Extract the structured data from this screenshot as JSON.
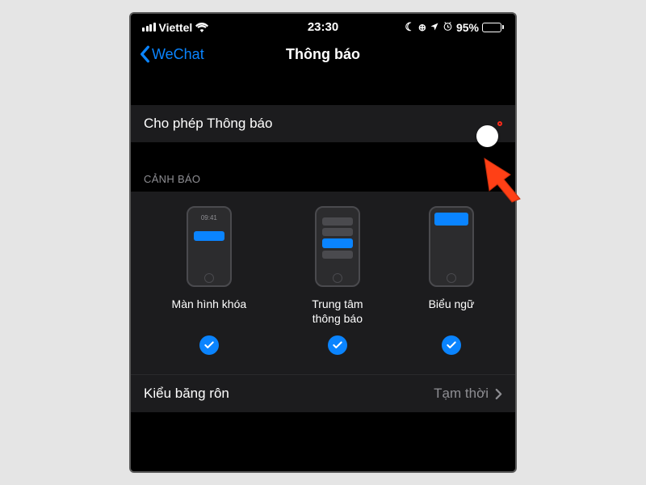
{
  "status_bar": {
    "carrier": "Viettel",
    "time": "23:30",
    "battery_pct": "95%",
    "icons": [
      "signal-icon",
      "wifi-icon",
      "moon-icon",
      "lock-rotation-icon",
      "location-icon",
      "alarm-icon",
      "battery-icon"
    ]
  },
  "nav": {
    "back_label": "WeChat",
    "title": "Thông báo"
  },
  "allow_notifications": {
    "label": "Cho phép Thông báo",
    "on": true
  },
  "alerts_section": {
    "header": "CẢNH BÁO",
    "lock_time": "09:41",
    "options": [
      {
        "label": "Màn hình khóa",
        "checked": true
      },
      {
        "label": "Trung tâm\nthông báo",
        "checked": true
      },
      {
        "label": "Biểu ngữ",
        "checked": true
      }
    ]
  },
  "banner_style": {
    "label": "Kiểu băng rôn",
    "value": "Tạm thời"
  },
  "colors": {
    "accent": "#0a84ff",
    "toggle_on": "#34c759",
    "highlight_border": "#ff2a1a"
  },
  "annotation": {
    "arrow": "pointer-arrow"
  }
}
